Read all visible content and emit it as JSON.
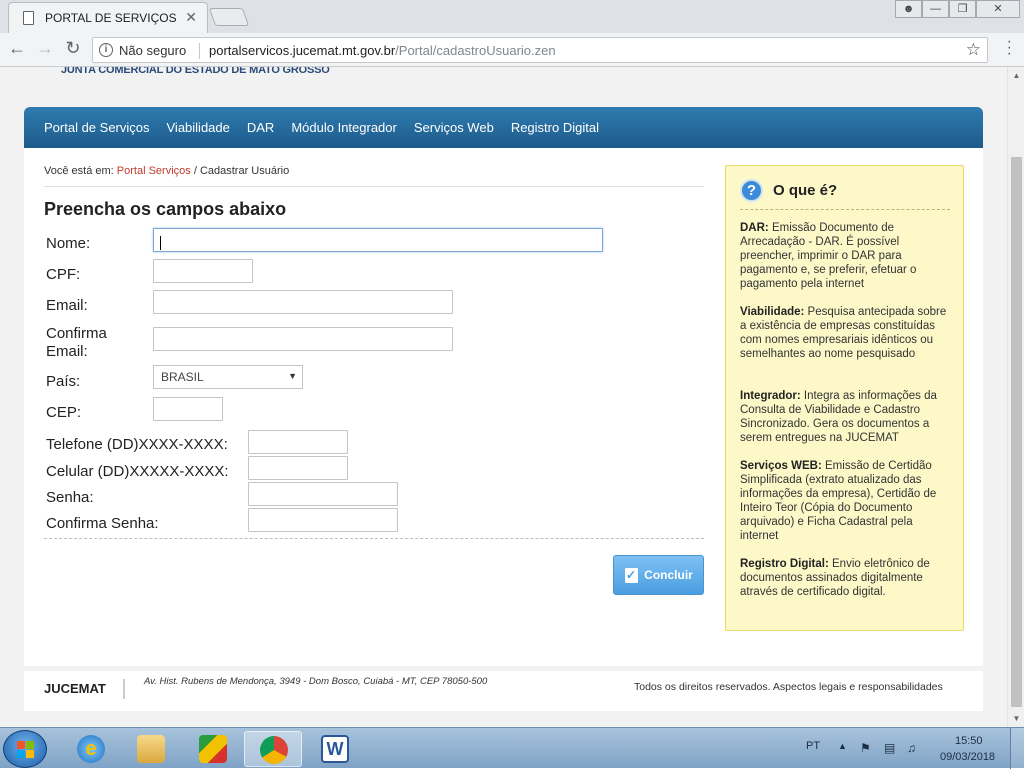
{
  "browser": {
    "tab_title": "PORTAL DE SERVIÇOS",
    "tab_close": "✕",
    "security_label": "Não seguro",
    "url_host": "portalservicos.jucemat.mt.gov.br",
    "url_path": "/Portal/cadastroUsuario.zen"
  },
  "page": {
    "logo_text": "JUNTA COMERCIAL DO ESTADO DE MATO GROSSO",
    "nav_items": [
      "Portal de Serviços",
      "Viabilidade",
      "DAR",
      "Módulo Integrador",
      "Serviços Web",
      "Registro Digital"
    ],
    "breadcrumb": {
      "prefix": "Você está em:",
      "link": "Portal Serviços",
      "separator": " / ",
      "current": "Cadastrar Usuário"
    },
    "form": {
      "title": "Preencha os campos abaixo",
      "labels": {
        "nome": "Nome:",
        "cpf": "CPF:",
        "email": "Email:",
        "confirma_email_1": "Confirma",
        "confirma_email_2": "Email:",
        "pais": "País:",
        "cep": "CEP:",
        "telefone": "Telefone (DD)XXXX-XXXX:",
        "celular": "Celular (DD)XXXXX-XXXX:",
        "senha": "Senha:",
        "confirma_senha": "Confirma Senha:"
      },
      "values": {
        "nome": "",
        "cpf": "",
        "email": "",
        "confirma_email": "",
        "pais": "BRASIL",
        "cep": "",
        "telefone": "",
        "celular": "",
        "senha": "",
        "confirma_senha": ""
      },
      "submit_label": "Concluir"
    },
    "help": {
      "title": "O que é?",
      "entries": [
        {
          "term": "DAR:",
          "text": " Emissão Documento de Arrecadação - DAR. É possível preencher, imprimir o DAR para pagamento e, se preferir, efetuar o pagamento pela internet"
        },
        {
          "term": "Viabilidade:",
          "text": " Pesquisa antecipada sobre a existência de empresas constituídas com nomes empresariais idênticos ou semelhantes ao nome pesquisado"
        },
        {
          "term": "Integrador:",
          "text": " Integra as informações da Consulta de Viabilidade e Cadastro Sincronizado. Gera os documentos a serem entregues na JUCEMAT"
        },
        {
          "term": "Serviços WEB:",
          "text": " Emissão de Certidão Simplificada (extrato atualizado das informações da empresa), Certidão de Inteiro Teor (Cópia do Documento arquivado) e Ficha Cadastral pela internet"
        },
        {
          "term": "Registro Digital:",
          "text": " Envio eletrônico de documentos assinados digitalmente através de certificado digital."
        }
      ]
    },
    "footer": {
      "brand": "JUCEMAT",
      "address": "Av. Hist. Rubens de Mendonça, 3949 - Dom Bosco, Cuiabá - MT, CEP 78050-500",
      "rights": "Todos os direitos reservados. Aspectos legais e responsabilidades"
    }
  },
  "taskbar": {
    "language": "PT",
    "time": "15:50",
    "date": "09/03/2018"
  }
}
